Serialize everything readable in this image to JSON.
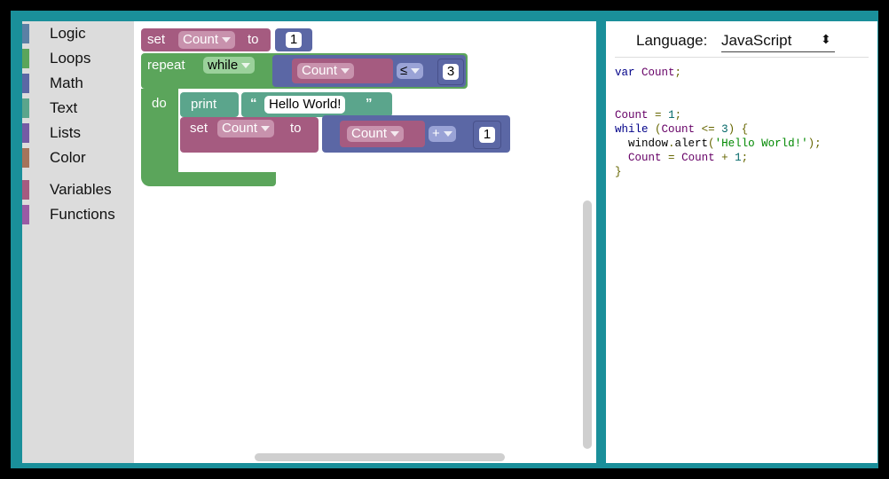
{
  "toolbox": {
    "categories": [
      {
        "label": "Logic",
        "color": "#5b80a5"
      },
      {
        "label": "Loops",
        "color": "#5ba55b"
      },
      {
        "label": "Math",
        "color": "#5b67a5"
      },
      {
        "label": "Text",
        "color": "#5ba58c"
      },
      {
        "label": "Lists",
        "color": "#745ba5"
      },
      {
        "label": "Color",
        "color": "#a5745b"
      },
      {
        "label": "Variables",
        "color": "#a55b80"
      },
      {
        "label": "Functions",
        "color": "#995ba5"
      }
    ]
  },
  "blocks": {
    "set1": {
      "keyword": "set",
      "variable": "Count",
      "to": "to",
      "value": "1"
    },
    "repeat": {
      "keyword": "repeat",
      "mode": "while",
      "variable": "Count",
      "operator": "≤",
      "value": "3",
      "do": "do"
    },
    "print": {
      "keyword": "print",
      "open_quote": "“",
      "text": "Hello World!",
      "close_quote": "”"
    },
    "set2": {
      "keyword": "set",
      "variable": "Count",
      "to": "to",
      "left": "Count",
      "operator": "+",
      "value": "1"
    }
  },
  "colors": {
    "variables": "#a55b80",
    "loops": "#5ba55b",
    "math": "#5b67a5",
    "text": "#5ba58c",
    "frame": "#1a8f9a"
  },
  "code_panel": {
    "language_label": "Language:",
    "language_value": "JavaScript",
    "lines": [
      "var Count;",
      "",
      "",
      "Count = 1;",
      "while (Count <= 3) {",
      "  window.alert('Hello World!');",
      "  Count = Count + 1;",
      "}"
    ]
  },
  "icons": {
    "trash": "trash-icon",
    "dropdown": "chevron-down-icon",
    "language_arrows": "updown-arrows-icon"
  }
}
